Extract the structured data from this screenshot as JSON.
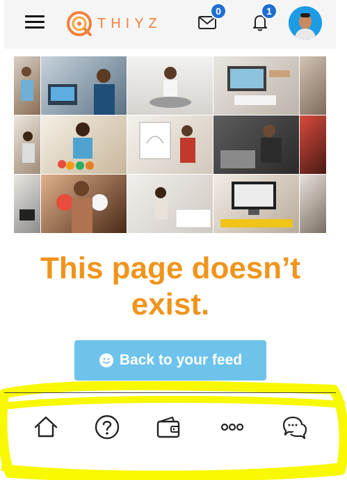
{
  "header": {
    "logo_text": "THIYZ",
    "mail_badge": "0",
    "notification_badge": "1"
  },
  "error": {
    "title": "This page doesn’t exist."
  },
  "back_button": {
    "label": "Back to your feed"
  },
  "bottom_nav": {
    "items": [
      "home-icon",
      "help-icon",
      "wallet-icon",
      "more-icon",
      "chat-icon"
    ]
  },
  "colors": {
    "brand_orange": "#f0803c",
    "title_orange": "#f0941c",
    "button_blue": "#6ec3ec",
    "badge_blue": "#1f6fd1",
    "highlight_yellow": "#f8f800"
  }
}
